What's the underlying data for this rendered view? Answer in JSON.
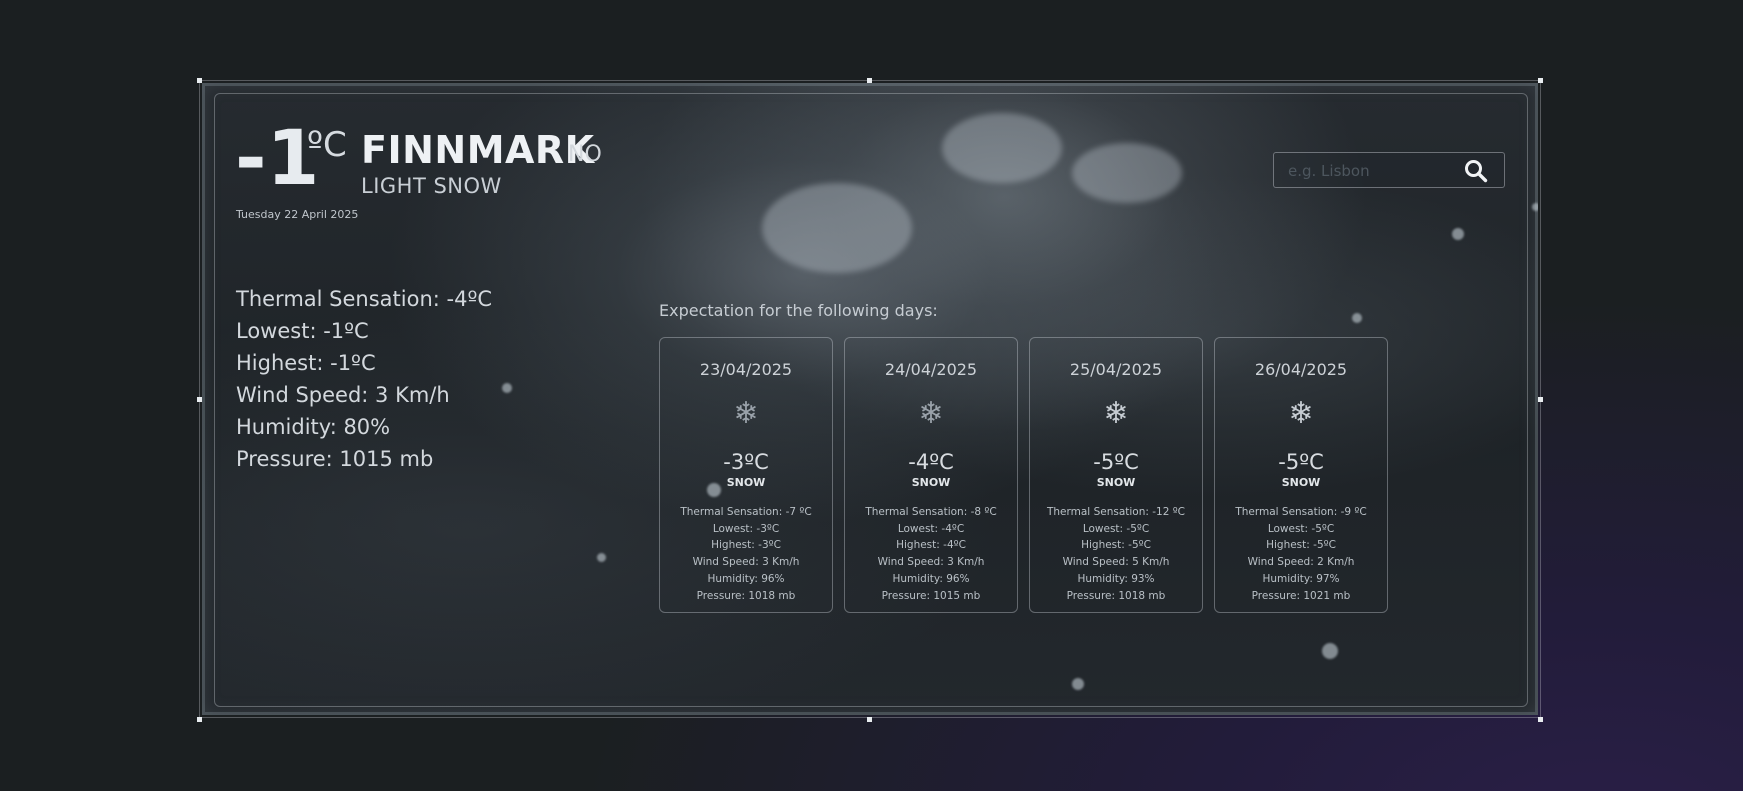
{
  "current": {
    "temp": "-1",
    "unit": "ºC",
    "city": "FINNMARK",
    "country": "NO",
    "description": "LIGHT SNOW",
    "date": "Tuesday 22 April 2025"
  },
  "stats": [
    "Thermal Sensation: -4ºC",
    "Lowest: -1ºC",
    "Highest: -1ºC",
    "Wind Speed: 3 Km/h",
    "Humidity: 80%",
    "Pressure: 1015 mb"
  ],
  "search": {
    "placeholder": "e.g. Lisbon",
    "value": "",
    "icon": "search-icon"
  },
  "forecast": {
    "title": "Expectation for the following days:",
    "days": [
      {
        "date": "23/04/2025",
        "icon": "snowflake-icon",
        "temp": "-3ºC",
        "condition": "SNOW",
        "details": [
          "Thermal Sensation: -7 ºC",
          "Lowest: -3ºC",
          "Highest: -3ºC",
          "Wind Speed: 3 Km/h",
          "Humidity: 96%",
          "Pressure: 1018 mb"
        ]
      },
      {
        "date": "24/04/2025",
        "icon": "snowflake-icon",
        "temp": "-4ºC",
        "condition": "SNOW",
        "details": [
          "Thermal Sensation: -8 ºC",
          "Lowest: -4ºC",
          "Highest: -4ºC",
          "Wind Speed: 3 Km/h",
          "Humidity: 96%",
          "Pressure: 1015 mb"
        ]
      },
      {
        "date": "25/04/2025",
        "icon": "snowflake-icon",
        "temp": "-5ºC",
        "condition": "SNOW",
        "details": [
          "Thermal Sensation: -12 ºC",
          "Lowest: -5ºC",
          "Highest: -5ºC",
          "Wind Speed: 5 Km/h",
          "Humidity: 93%",
          "Pressure: 1018 mb"
        ]
      },
      {
        "date": "26/04/2025",
        "icon": "snowflake-icon",
        "temp": "-5ºC",
        "condition": "SNOW",
        "details": [
          "Thermal Sensation: -9 ºC",
          "Lowest: -5ºC",
          "Highest: -5ºC",
          "Wind Speed: 2 Km/h",
          "Humidity: 97%",
          "Pressure: 1021 mb"
        ]
      }
    ]
  }
}
